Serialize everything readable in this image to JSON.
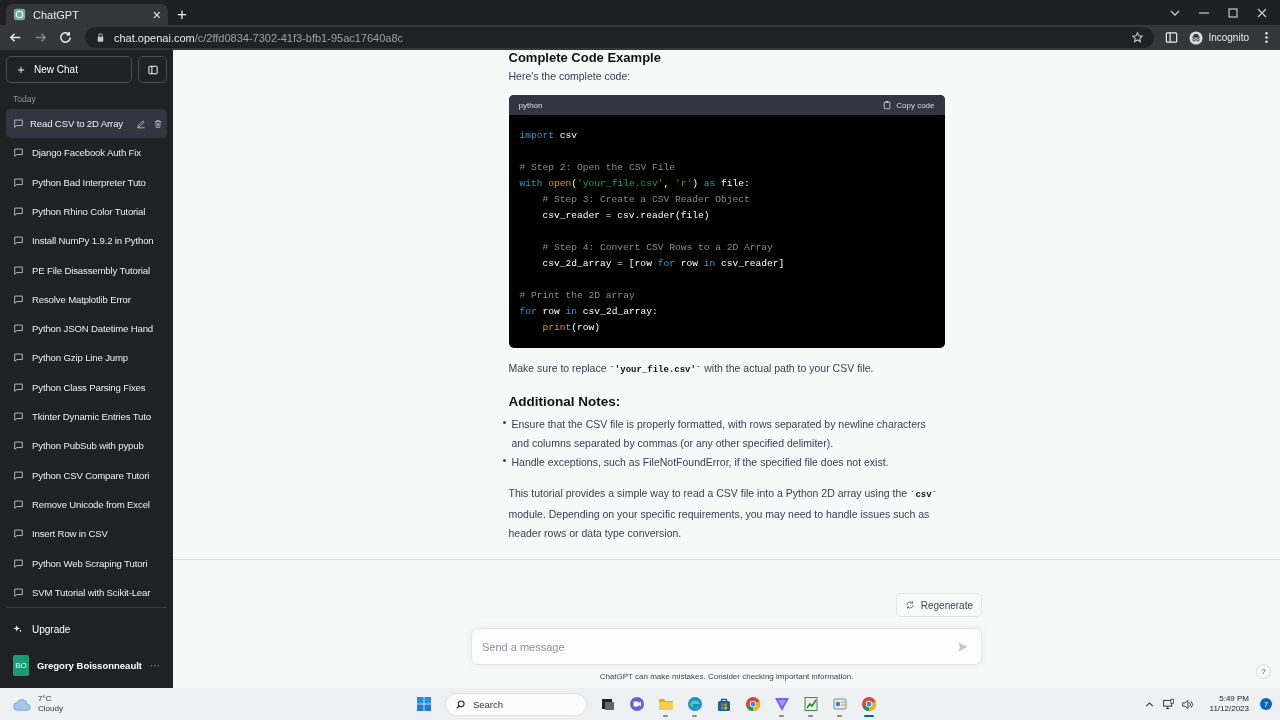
{
  "browser": {
    "tab": {
      "title": "ChatGPT",
      "close": "×"
    },
    "new_tab": "+",
    "address": {
      "host": "chat.openai.com",
      "path": "/c/2ffd0834-7302-41f3-bfb1-95ac17640a8c"
    },
    "nav": [
      {
        "kind": "back",
        "disabled": false
      },
      {
        "kind": "forward",
        "disabled": true
      },
      {
        "kind": "reload",
        "disabled": false
      }
    ],
    "profile": "Incognito"
  },
  "sidebar": {
    "new_chat": "New Chat",
    "section": "Today",
    "items": [
      {
        "title": "Read CSV to 2D Array",
        "selected": true
      },
      {
        "title": "Django Facebook Auth Fix",
        "selected": false
      },
      {
        "title": "Python Bad Interpreter Tuto",
        "selected": false
      },
      {
        "title": "Python Rhino Color Tutorial",
        "selected": false
      },
      {
        "title": "Install NumPy 1.9.2 in Python",
        "selected": false
      },
      {
        "title": "PE File Disassembly Tutorial",
        "selected": false
      },
      {
        "title": "Resolve Matplotlib Error",
        "selected": false
      },
      {
        "title": "Python JSON Datetime Hand",
        "selected": false
      },
      {
        "title": "Python Gzip Line Jump",
        "selected": false
      },
      {
        "title": "Python Class Parsing Fixes",
        "selected": false
      },
      {
        "title": "Tkinter Dynamic Entries Tuto",
        "selected": false
      },
      {
        "title": "Python PubSub with pypub",
        "selected": false
      },
      {
        "title": "Python CSV Compare Tutori",
        "selected": false
      },
      {
        "title": "Remove Unicode from Excel",
        "selected": false
      },
      {
        "title": "Insert Row in CSV",
        "selected": false
      },
      {
        "title": "Python Web Scraping Tutori",
        "selected": false
      },
      {
        "title": "SVM Tutorial with Scikit-Lear",
        "selected": false
      }
    ],
    "upgrade": "Upgrade",
    "user": {
      "initials": "BO",
      "name": "Gregory Boissonneault",
      "more": "···"
    }
  },
  "thread": {
    "heading": "Complete Code Example",
    "intro": "Here's the complete code:",
    "code": {
      "language": "python",
      "copy_label": "Copy code",
      "lines": [
        {
          "kind": "code",
          "tokens": [
            {
              "kind": "kw",
              "text": "import"
            },
            {
              "kind": "plain",
              "text": " csv"
            }
          ]
        },
        {
          "kind": "blank"
        },
        {
          "kind": "code",
          "tokens": [
            {
              "kind": "cmt",
              "text": "# Step 2: Open the CSV File"
            }
          ]
        },
        {
          "kind": "code",
          "tokens": [
            {
              "kind": "kw",
              "text": "with"
            },
            {
              "kind": "fn",
              "text": " open"
            },
            {
              "kind": "plain",
              "text": "("
            },
            {
              "kind": "str",
              "text": "'your_file.csv'"
            },
            {
              "kind": "plain",
              "text": ", "
            },
            {
              "kind": "str",
              "text": "'r'"
            },
            {
              "kind": "plain",
              "text": ") "
            },
            {
              "kind": "kw",
              "text": "as"
            },
            {
              "kind": "plain",
              "text": " file:"
            }
          ]
        },
        {
          "kind": "code",
          "indented": true,
          "tokens": [
            {
              "kind": "cmt",
              "text": "# Step 3: Create a CSV Reader Object"
            }
          ]
        },
        {
          "kind": "code",
          "indented": true,
          "tokens": [
            {
              "kind": "plain",
              "text": "csv_reader = csv.reader(file)"
            }
          ]
        },
        {
          "kind": "blank"
        },
        {
          "kind": "code",
          "indented": true,
          "tokens": [
            {
              "kind": "cmt",
              "text": "# Step 4: Convert CSV Rows to a 2D Array"
            }
          ]
        },
        {
          "kind": "code",
          "indented": true,
          "tokens": [
            {
              "kind": "plain",
              "text": "csv_2d_array = [row "
            },
            {
              "kind": "kw",
              "text": "for"
            },
            {
              "kind": "plain",
              "text": " row "
            },
            {
              "kind": "kw",
              "text": "in"
            },
            {
              "kind": "plain",
              "text": " csv_reader]"
            }
          ]
        },
        {
          "kind": "blank"
        },
        {
          "kind": "code",
          "tokens": [
            {
              "kind": "cmt",
              "text": "# Print the 2D array"
            }
          ]
        },
        {
          "kind": "code",
          "tokens": [
            {
              "kind": "kw",
              "text": "for"
            },
            {
              "kind": "plain",
              "text": " row "
            },
            {
              "kind": "kw",
              "text": "in"
            },
            {
              "kind": "plain",
              "text": " csv_2d_array:"
            }
          ]
        },
        {
          "kind": "code",
          "indented": true,
          "tokens": [
            {
              "kind": "fn",
              "text": "print"
            },
            {
              "kind": "plain",
              "text": "(row)"
            }
          ]
        }
      ]
    },
    "note": [
      {
        "kind": "text",
        "text": "Make sure to replace "
      },
      {
        "kind": "code",
        "text": "`'your_file.csv'`"
      },
      {
        "kind": "text",
        "text": " with the actual path to your CSV file."
      }
    ],
    "notes_heading": "Additional Notes:",
    "bullets": [
      "Ensure that the CSV file is properly formatted, with rows separated by newline characters and columns separated by commas (or any other specified delimiter).",
      "Handle exceptions, such as FileNotFoundError, if the specified file does not exist."
    ],
    "closing": [
      {
        "kind": "text",
        "text": "This tutorial provides a simple way to read a CSV file into a Python 2D array using the "
      },
      {
        "kind": "code",
        "text": "`csv`"
      },
      {
        "kind": "text",
        "text": " module. Depending on your specific requirements, you may need to handle issues such as header rows or data type conversion."
      }
    ]
  },
  "composer": {
    "regenerate": "Regenerate",
    "placeholder": "Send a message",
    "disclaimer": "ChatGPT can make mistakes. Consider checking important information.",
    "help": "?"
  },
  "taskbar": {
    "weather": {
      "temp": "7°C",
      "condition": "Cloudy"
    },
    "search": "Search",
    "apps": [
      {
        "kind": "taskview",
        "running": false,
        "selected": false
      },
      {
        "kind": "chat",
        "running": false,
        "selected": false
      },
      {
        "kind": "folder",
        "running": true,
        "selected": false
      },
      {
        "kind": "edge",
        "running": true,
        "selected": false
      },
      {
        "kind": "store",
        "running": false,
        "selected": false
      },
      {
        "kind": "chrome",
        "running": false,
        "selected": false
      },
      {
        "kind": "triangle",
        "running": true,
        "selected": false
      },
      {
        "kind": "chart",
        "running": true,
        "selected": false
      },
      {
        "kind": "tool",
        "running": true,
        "selected": false
      },
      {
        "kind": "chrome",
        "running": true,
        "selected": true
      }
    ],
    "clock": {
      "time": "5:49 PM",
      "date": "11/12/2023"
    },
    "badge": "7"
  }
}
